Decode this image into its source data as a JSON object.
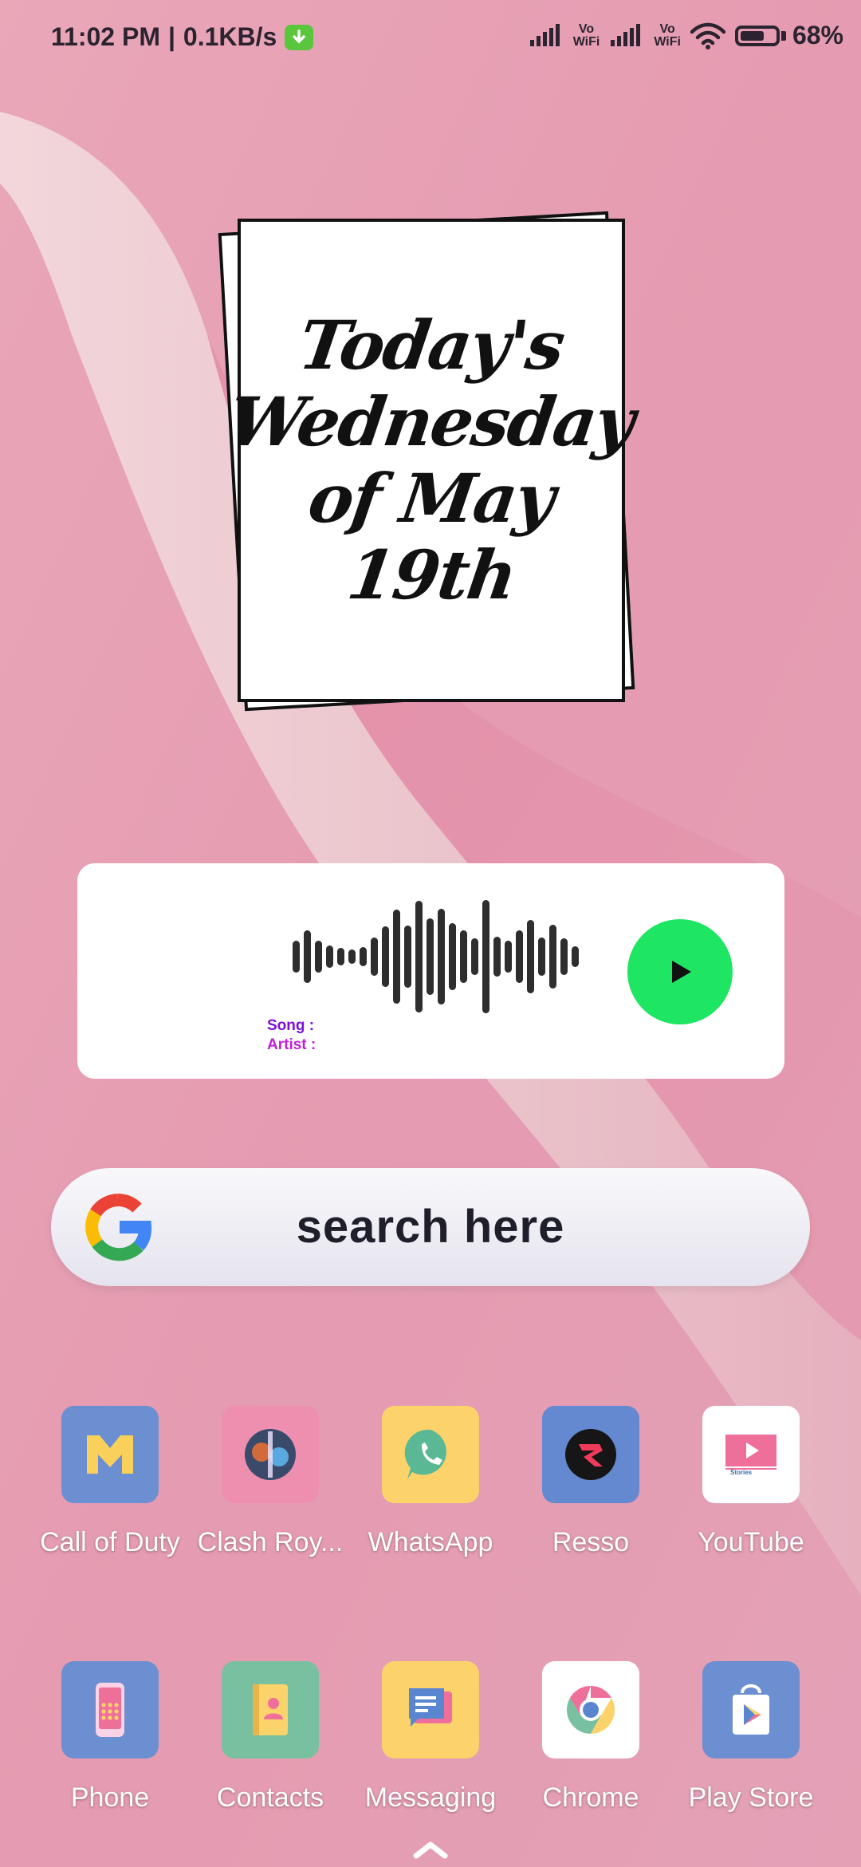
{
  "status_bar": {
    "time": "11:02 PM",
    "net_speed": "0.1KB/s",
    "vowifi_1": "Vo\nWiFi",
    "vowifi_2": "Vo\nWiFi",
    "battery": "68%"
  },
  "date_widget": {
    "line1": "Today's",
    "line2": "Wednesday",
    "line3": "of May",
    "line4": "19th"
  },
  "music_widget": {
    "song_label": "Song :",
    "artist_label": "Artist :",
    "play_icon": "play-icon"
  },
  "search": {
    "text": "search here",
    "logo": "google-icon"
  },
  "apps_row1": [
    {
      "label": "Call of Duty",
      "icon": "call-of-duty-icon",
      "bg": "#6b8fd0"
    },
    {
      "label": "Clash Roy...",
      "icon": "clash-royale-icon",
      "bg": "#ee8fb0"
    },
    {
      "label": "WhatsApp",
      "icon": "whatsapp-icon",
      "bg": "#fbd36a"
    },
    {
      "label": "Resso",
      "icon": "resso-icon",
      "bg": "#6489d0"
    },
    {
      "label": "YouTube",
      "icon": "youtube-icon",
      "bg": "#ffffff"
    }
  ],
  "apps_row2": [
    {
      "label": "Phone",
      "icon": "phone-icon",
      "bg": "#6b8fd0"
    },
    {
      "label": "Contacts",
      "icon": "contacts-icon",
      "bg": "#79c0a0"
    },
    {
      "label": "Messaging",
      "icon": "messaging-icon",
      "bg": "#fbd36a"
    },
    {
      "label": "Chrome",
      "icon": "chrome-icon",
      "bg": "#ffffff"
    },
    {
      "label": "Play Store",
      "icon": "play-store-icon",
      "bg": "#6b8fd0"
    }
  ],
  "colors": {
    "wallpaper": "#e7a3b6",
    "play_button": "#1ee562",
    "song_label": "#7a10d6",
    "artist_label": "#c020d8"
  }
}
